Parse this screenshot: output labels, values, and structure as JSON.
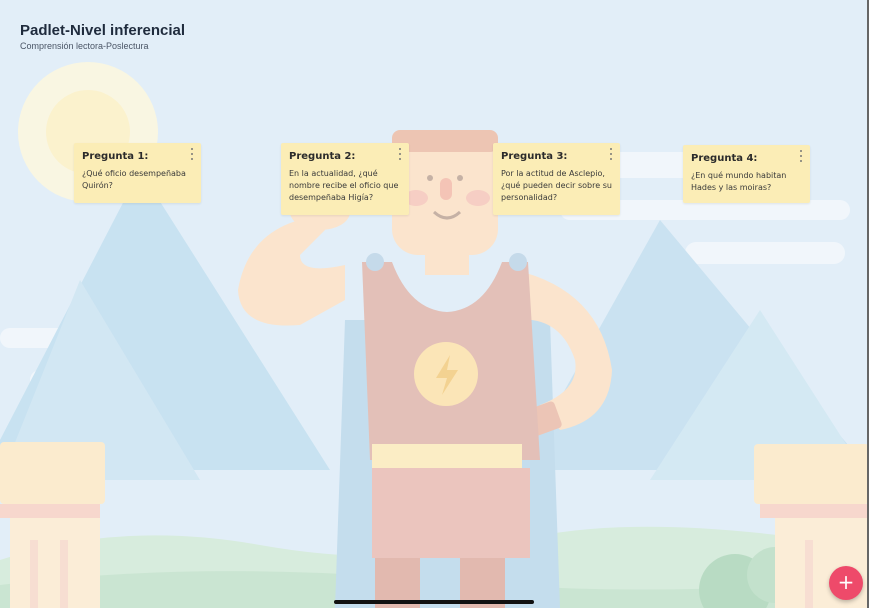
{
  "board": {
    "title": "Padlet-Nivel inferencial",
    "subtitle": "Comprensión lectora-Poslectura"
  },
  "cards": [
    {
      "title": "Pregunta 1:",
      "body": "¿Qué oficio desempeñaba Quirón?"
    },
    {
      "title": "Pregunta 2:",
      "body": "En la actualidad, ¿qué nombre recibe el oficio que desempeñaba Higía?"
    },
    {
      "title": "Pregunta 3:",
      "body": "Por la actitud de Asclepio, ¿qué pueden decir sobre su personalidad?"
    },
    {
      "title": "Pregunta 4:",
      "body": "¿En qué mundo habitan Hades y las moiras?"
    }
  ],
  "fab": {
    "label": "+",
    "icon": "plus-icon"
  },
  "colors": {
    "card": "#fbedb6",
    "fab": "#ee4a6a",
    "sky": "#dcebf7"
  }
}
